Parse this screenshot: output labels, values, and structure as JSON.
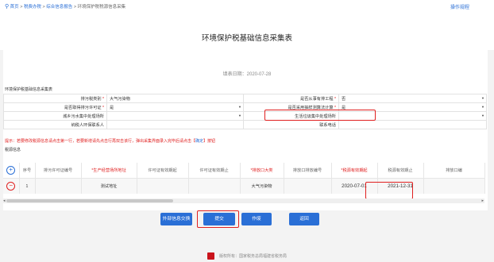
{
  "breadcrumb": {
    "home": "首页",
    "sep": ">",
    "items": [
      "税费办税",
      "综合信息报告",
      "环境保护税税源信息采集"
    ]
  },
  "operation_guide": "操作规程",
  "page_title": "环境保护税基础信息采集表",
  "fill_date": "填表日期：2020-07-28",
  "section1_title": "环境保护税基础信息采集表",
  "form": {
    "pollutant_type_label": "排污税类别",
    "pollutant_type_value": "大气污染物",
    "engineering_label": "是否从事有排工程",
    "engineering_value": "否",
    "permit_label": "是否取得排污许可证",
    "permit_value": "是",
    "special_method_label": "是否采用抽样测算法计算",
    "special_method_value": "是",
    "urban_sewage_label": "城乡污水集中处理场所",
    "waste_label": "生活垃圾集中处理场所",
    "contact_label": "纳税人环保联系人",
    "phone_label": "联系电话"
  },
  "tip": {
    "text": "提示：若要修改税源信息请点击第一行，若要新增请先点击行再双击该行，弹出采集界面录入完毕后请点击【",
    "action": "确定",
    "end": "】按钮"
  },
  "section2_title": "税源信息",
  "grid": {
    "headers": [
      "序号",
      "排污许可证编号",
      "生产经营场所地址",
      "许可证有效期起",
      "许可证有效期止",
      "排放口大类",
      "排放口排放编号",
      "税源有效期起",
      "税源有效期止",
      "排放口编"
    ],
    "rows": [
      {
        "seq": "1",
        "permit_no": "",
        "address": "测试地址",
        "permit_from": "",
        "permit_to": "",
        "category": "大气污染物",
        "outlet_no": "",
        "valid_from": "2020-07-01",
        "valid_to": "2021-12-31",
        "outlet_code": ""
      }
    ]
  },
  "buttons": {
    "external": "外部信息交换",
    "submit": "提交",
    "void": "作废",
    "back": "返回"
  },
  "footer": "版权所有：国家税务总局福建省税务局",
  "colors": {
    "accent": "#2a6fd6",
    "highlight": "#e02020"
  }
}
